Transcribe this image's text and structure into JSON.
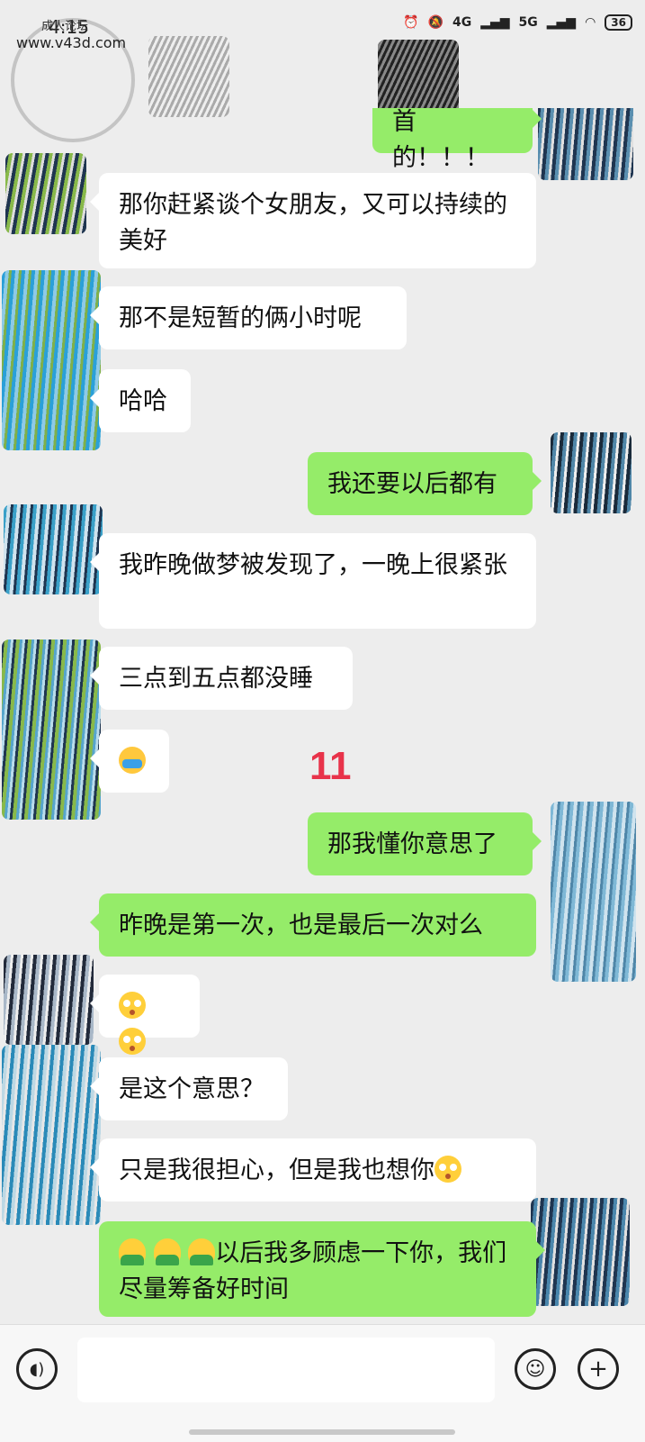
{
  "status_bar": {
    "time": "4:15",
    "network1": "4G",
    "network2": "5G",
    "battery": "36"
  },
  "watermark": {
    "line1": "成人论坛",
    "line2": "www.v43d.com"
  },
  "messages": [
    {
      "side": "out",
      "text": "首的！！！"
    },
    {
      "side": "in",
      "text": "那你赶紧谈个女朋友，又可以持续的美好"
    },
    {
      "side": "in",
      "text": "那不是短暂的俩小时呢"
    },
    {
      "side": "in",
      "text": "哈哈"
    },
    {
      "side": "out",
      "text": "我还要以后都有"
    },
    {
      "side": "in",
      "text": "我昨晚做梦被发现了，一晚上很紧张"
    },
    {
      "side": "in",
      "text": "三点到五点都没睡"
    },
    {
      "side": "in",
      "emoji": "crying-laughing-emoji"
    },
    {
      "side": "out",
      "text": "那我懂你意思了"
    },
    {
      "side": "out",
      "text": "昨晚是第一次，也是最后一次对么"
    },
    {
      "side": "in",
      "emoji": "flushed-emoji"
    },
    {
      "side": "in",
      "text": "是这个意思？"
    },
    {
      "side": "in",
      "text": "只是我很担心，但是我也想你",
      "emoji_suffix": "flushed-emoji"
    },
    {
      "side": "out",
      "text": "以后我多顾虑一下你，我们尽量筹备好时间",
      "emoji_prefix": "person-emoji"
    }
  ],
  "annotation": "11",
  "colors": {
    "background": "#ededed",
    "incoming_bubble": "#ffffff",
    "outgoing_bubble": "#95ec69",
    "annotation_red": "#e8334a"
  }
}
